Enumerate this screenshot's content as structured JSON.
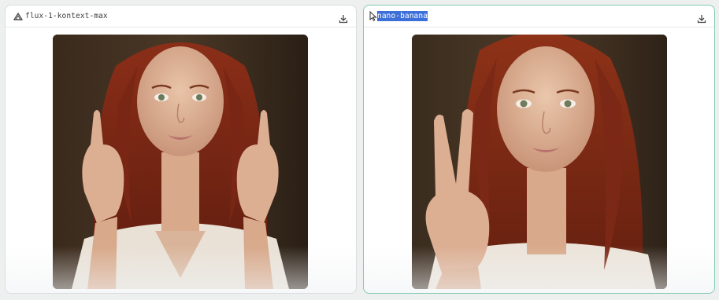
{
  "panels": [
    {
      "model_name": "flux-1-kontext-max",
      "model_icon": "flux-logo-icon",
      "download_icon": "download-icon",
      "image_description_icon": "generated-portrait-image"
    },
    {
      "model_name": "nano-banana",
      "model_icon": "cursor-icon",
      "download_icon": "download-icon",
      "image_description_icon": "generated-portrait-image"
    }
  ],
  "colors": {
    "selected_border": "#7fc9b1",
    "selection_highlight": "#3d6fd9",
    "panel_border": "#d9dcdf"
  }
}
